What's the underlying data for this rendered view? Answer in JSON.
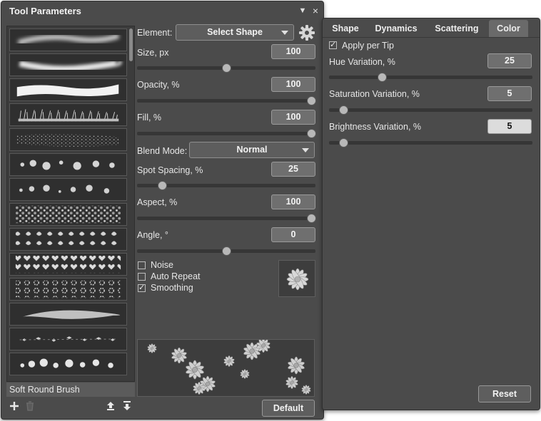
{
  "window": {
    "title": "Tool Parameters",
    "menu_icon": "dropdown-arrow-icon",
    "close_glyph": "×"
  },
  "brush_list": {
    "selected": "Soft Round Brush",
    "items": [
      {
        "kind": "soft-stroke"
      },
      {
        "kind": "soft-stroke-wide"
      },
      {
        "kind": "hard-wavy"
      },
      {
        "kind": "grass"
      },
      {
        "kind": "speckle"
      },
      {
        "kind": "spheres"
      },
      {
        "kind": "spheres-small"
      },
      {
        "kind": "texture"
      },
      {
        "kind": "leaves"
      },
      {
        "kind": "hearts"
      },
      {
        "kind": "flowers"
      },
      {
        "kind": "ribbon"
      },
      {
        "kind": "scatter-stars"
      },
      {
        "kind": "bubbles"
      }
    ]
  },
  "params": {
    "element_label": "Element:",
    "element_value": "Select Shape",
    "size": {
      "label": "Size, px",
      "value": "100",
      "fraction": 0.5
    },
    "opacity": {
      "label": "Opacity, %",
      "value": "100",
      "fraction": 1.0
    },
    "fill": {
      "label": "Fill, %",
      "value": "100",
      "fraction": 1.0
    },
    "blend_label": "Blend Mode:",
    "blend_value": "Normal",
    "spacing": {
      "label": "Spot Spacing, %",
      "value": "25",
      "fraction": 0.14
    },
    "aspect": {
      "label": "Aspect, %",
      "value": "100",
      "fraction": 1.0
    },
    "angle": {
      "label": "Angle, °",
      "value": "0",
      "fraction": 0.5
    },
    "noise": {
      "label": "Noise",
      "checked": false
    },
    "auto_repeat": {
      "label": "Auto Repeat",
      "checked": false
    },
    "smoothing": {
      "label": "Smoothing",
      "checked": true
    },
    "default_button": "Default"
  },
  "tabs": [
    {
      "label": "Shape",
      "active": false
    },
    {
      "label": "Dynamics",
      "active": false
    },
    {
      "label": "Scattering",
      "active": false
    },
    {
      "label": "Color",
      "active": true
    }
  ],
  "color_tab": {
    "apply_per_tip": {
      "label": "Apply per Tip",
      "checked": true
    },
    "hue": {
      "label": "Hue Variation, %",
      "value": "25",
      "fraction": 0.26
    },
    "saturation": {
      "label": "Saturation Variation, %",
      "value": "5",
      "fraction": 0.07
    },
    "brightness": {
      "label": "Brightness Variation, %",
      "value": "5",
      "fraction": 0.07
    },
    "reset_button": "Reset"
  },
  "colors": {
    "panel": "#4b4b4b",
    "track": "#363636",
    "thumb": "#b8b8b8",
    "active_tab": "#6a6a6a"
  },
  "check_glyph": "✓"
}
